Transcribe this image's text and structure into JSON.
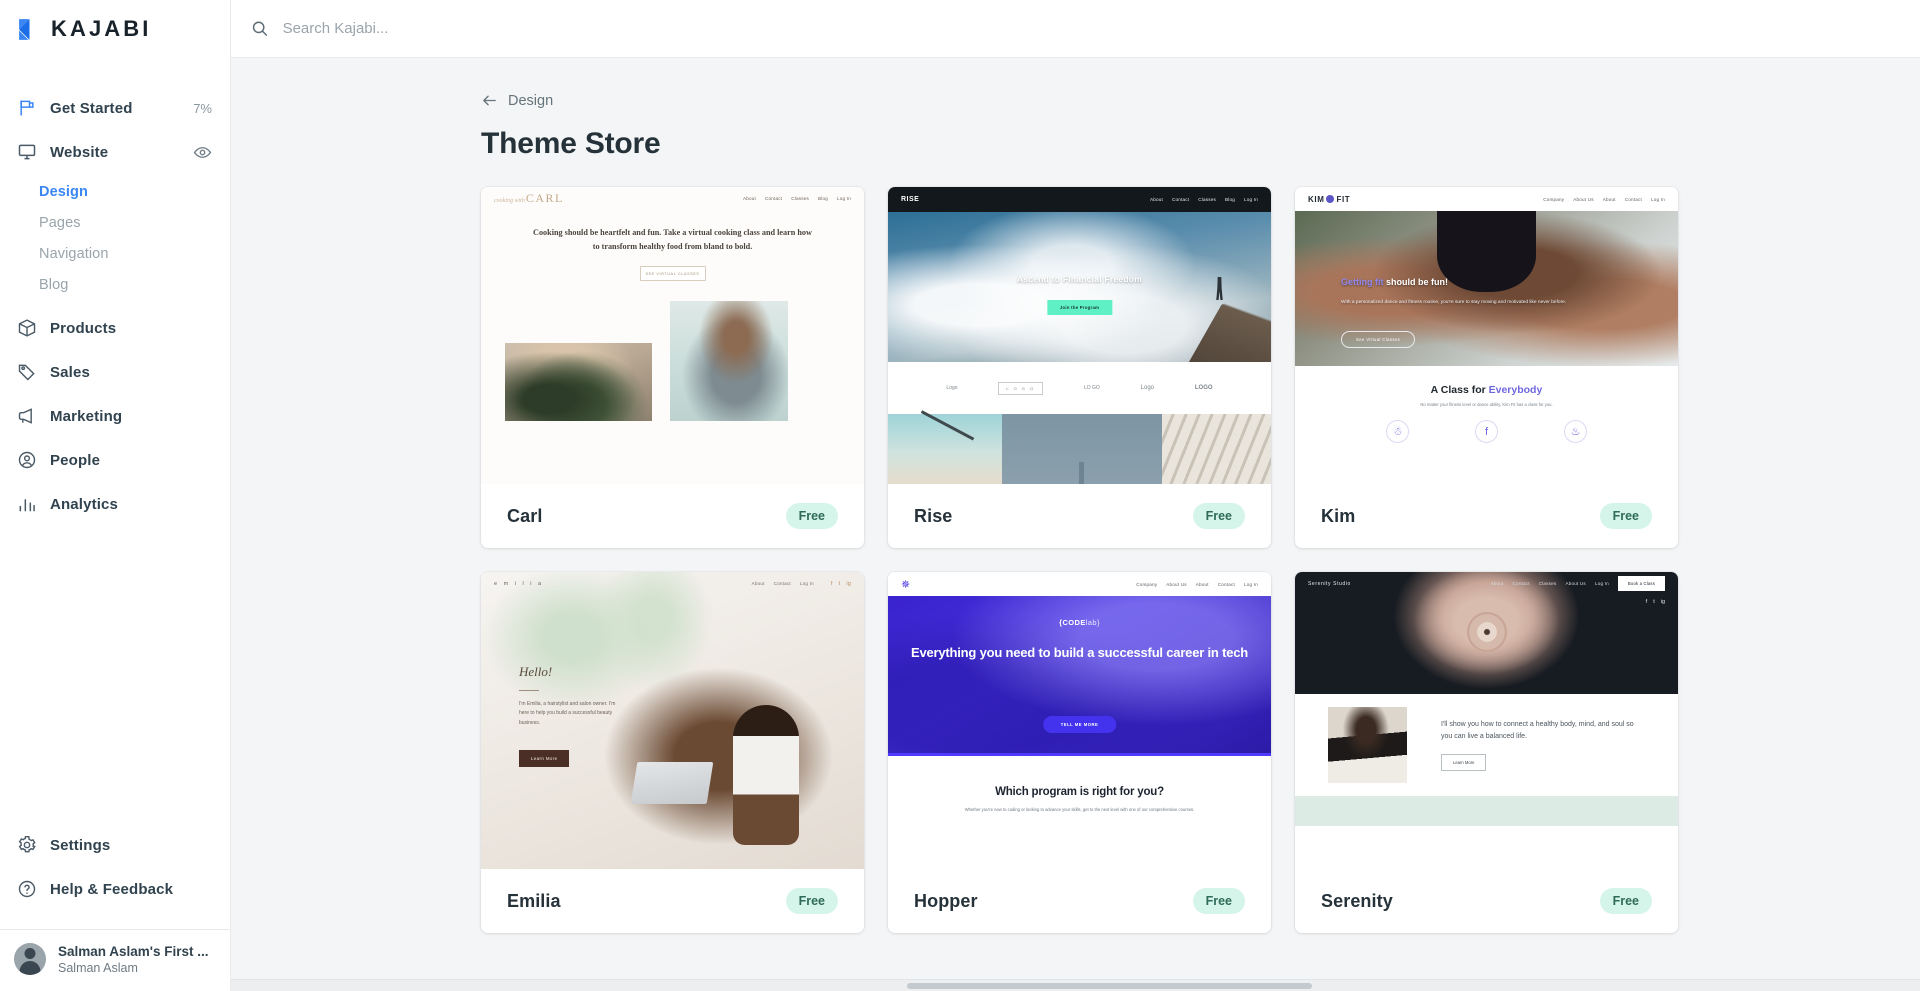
{
  "brand": {
    "name": "KAJABI",
    "logo_icon": "kajabi-logo-icon",
    "accent_color": "#3a86f5"
  },
  "search": {
    "placeholder": "Search Kajabi...",
    "value": "",
    "icon": "search-icon"
  },
  "sidebar": {
    "items": [
      {
        "label": "Get Started",
        "icon": "flag-icon",
        "meta": "7%"
      },
      {
        "label": "Website",
        "icon": "monitor-icon",
        "action_icon": "eye-icon"
      },
      {
        "label": "Products",
        "icon": "box-icon"
      },
      {
        "label": "Sales",
        "icon": "tag-icon"
      },
      {
        "label": "Marketing",
        "icon": "megaphone-icon"
      },
      {
        "label": "People",
        "icon": "person-circle-icon"
      },
      {
        "label": "Analytics",
        "icon": "bar-chart-icon"
      }
    ],
    "website_subitems": [
      {
        "label": "Design",
        "active": true
      },
      {
        "label": "Pages",
        "active": false
      },
      {
        "label": "Navigation",
        "active": false
      },
      {
        "label": "Blog",
        "active": false
      }
    ],
    "bottom_items": [
      {
        "label": "Settings",
        "icon": "gear-icon"
      },
      {
        "label": "Help & Feedback",
        "icon": "question-circle-icon"
      }
    ],
    "user": {
      "site": "Salman Aslam's First ...",
      "name": "Salman Aslam",
      "avatar": "avatar-icon"
    }
  },
  "main": {
    "breadcrumb": {
      "label": "Design",
      "icon": "arrow-left-icon"
    },
    "title": "Theme Store",
    "badge_free": "Free",
    "themes": [
      {
        "name": "Carl",
        "price": "Free",
        "preview": {
          "logo": "CARL",
          "logo_script": "cooking with",
          "nav": [
            "About",
            "Contact",
            "Classes",
            "Blog",
            "Log In"
          ],
          "headline": "Cooking should be heartfelt and fun. Take a virtual cooking class and learn how to transform healthy food from bland to bold.",
          "cta": "SEE VIRTUAL CLASSES"
        }
      },
      {
        "name": "Rise",
        "price": "Free",
        "preview": {
          "logo": "RISE",
          "nav": [
            "About",
            "Contact",
            "Classes",
            "Blog",
            "Log In"
          ],
          "headline": "Ascend to Financial Freedom",
          "cta": "Join the Program",
          "logo_strip": [
            "Logo",
            "L O G O",
            "LO GO",
            "Logo",
            "LOGO"
          ]
        }
      },
      {
        "name": "Kim",
        "price": "Free",
        "preview": {
          "logo": "KIM",
          "logo_suffix": "FIT",
          "nav": [
            "Company",
            "About Us",
            "About",
            "Contact",
            "Log In"
          ],
          "headline_accent": "Getting fit",
          "headline_rest": " should be fun!",
          "subhead": "With a personalized dance and fitness routine, you're sure to stay moving and motivated like never before.",
          "cta": "See Virtual Classes",
          "section_title": "A Class for ",
          "section_title_accent": "Everybody",
          "section_sub": "No matter your fitness level or dance ability, Kim Fit has a class for you."
        }
      },
      {
        "name": "Emilia",
        "price": "Free",
        "preview": {
          "logo": "e m i l i a",
          "nav": [
            "About",
            "Contact",
            "Log In"
          ],
          "socials": [
            "f",
            "t",
            "ig"
          ],
          "headline": "Hello!",
          "body": "I'm Emilia, a hairstylist and salon owner. I'm here to help you build a successful beauty business.",
          "cta": "Learn More"
        }
      },
      {
        "name": "Hopper",
        "price": "Free",
        "preview": {
          "logo": "hopper-star-icon",
          "nav": [
            "Company",
            "About Us",
            "About",
            "Contact",
            "Log In"
          ],
          "brand": "{CODE",
          "brand_suffix": "lab}",
          "headline": "Everything you need to build a successful career in tech",
          "cta": "TELL ME MORE",
          "section_title": "Which program is right for you?",
          "section_sub": "Whether you're new to coding or looking to advance your skills, get to the next level with one of our comprehensive courses."
        }
      },
      {
        "name": "Serenity",
        "price": "Free",
        "preview": {
          "logo": "Serenity Studio",
          "nav": [
            "About",
            "Contact",
            "Classes",
            "About Us",
            "Log In"
          ],
          "cta_top": "Book a Class",
          "socials": [
            "f",
            "t",
            "ig"
          ],
          "body": "I'll show you how to connect a healthy body, mind, and soul so you can live a balanced life.",
          "cta": "Learn More"
        }
      }
    ]
  }
}
